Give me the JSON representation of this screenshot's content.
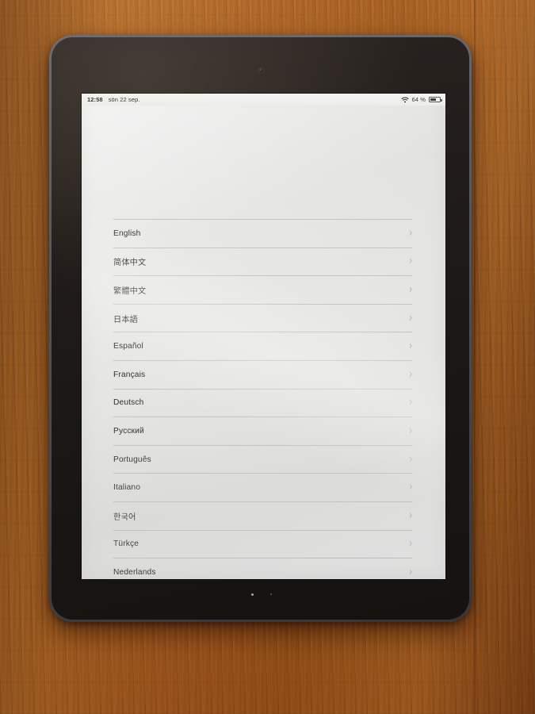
{
  "device": {
    "kind": "tablet",
    "camera_icon": "front-camera-dot",
    "body_color": "#55555a",
    "bezel_color": "#1a1715"
  },
  "background": {
    "surface": "wooden-table",
    "color": "#a75f21"
  },
  "status_bar": {
    "time": "12:58",
    "date": "sön 22 sep.",
    "wifi_icon": "wifi-icon",
    "battery_percent": "64 %",
    "battery_icon": "battery-icon",
    "battery_level": 64
  },
  "screen": {
    "title": "",
    "background_color": "#e7e7e5",
    "text_color": "#2c2c2c",
    "separator_color": "#96988e",
    "chevron_icon": "chevron-right-icon"
  },
  "language_list": {
    "items": [
      {
        "label": "English"
      },
      {
        "label": "简体中文"
      },
      {
        "label": "繁體中文"
      },
      {
        "label": "日本語"
      },
      {
        "label": "Español"
      },
      {
        "label": "Français"
      },
      {
        "label": "Deutsch"
      },
      {
        "label": "Русский"
      },
      {
        "label": "Português"
      },
      {
        "label": "Italiano"
      },
      {
        "label": "한국어"
      },
      {
        "label": "Türkçe"
      },
      {
        "label": "Nederlands"
      }
    ]
  }
}
